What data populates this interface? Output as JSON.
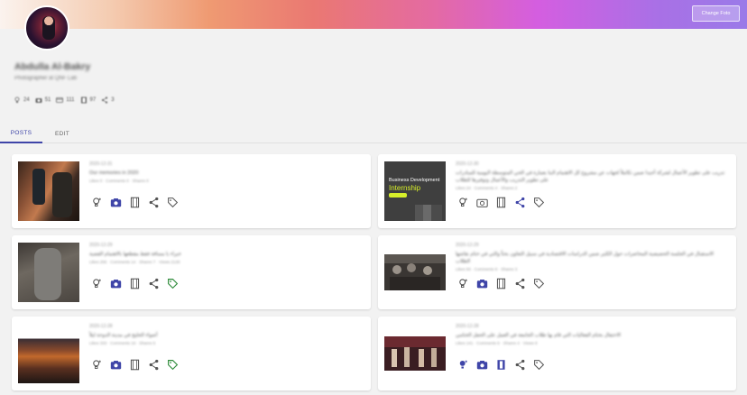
{
  "banner": {
    "change_photo": "Change Foto"
  },
  "profile": {
    "name": "Abdulla Al-Bakry",
    "role": "Photographer at QNF Lab",
    "stats": [
      {
        "icon": "bulb-icon",
        "value": "24"
      },
      {
        "icon": "camera-icon",
        "value": "51"
      },
      {
        "icon": "card-icon",
        "value": "111"
      },
      {
        "icon": "film-icon",
        "value": "97"
      },
      {
        "icon": "share-icon",
        "value": "3"
      }
    ]
  },
  "tabs": {
    "posts": "POSTS",
    "edit": "EDIT"
  },
  "posts": [
    {
      "date": "2020-12-31",
      "title": "Our memories in 2020",
      "stats": "Likes 0 · Comments 0 · Shares 0"
    },
    {
      "date": "2020-12-30",
      "title": "تدريب على تطوير الأعمال لشركة أجيدا ضمن تكاملاً لجهات عن مشروع كل الاهتمام البنا بعمارة في الحي المتوسطة اليومية للمبادرات على تطوير التدريب والأعمال وتوفيرها للطلاب",
      "stats": "Likes 24 · Comments 4 · Shares 2",
      "image_line1": "Business Development",
      "image_line2": "Internship"
    },
    {
      "date": "2020-12-29",
      "title": "خبراء يا مسافة فقط مقطعها بالاهتمام القضية",
      "stats": "Likes 256 · Comments 14 · Shares 7 · Views 2130"
    },
    {
      "date": "2020-12-29",
      "title": "الاستقبال في الجلسة الحضيضية المحاضرات حول الكثير ضمن الدراسات الاقتصادية في سبيل التعاون بحثاً والتي في ختام نقاشها الطلاب",
      "stats": "Likes 93 · Comments 8 · Shares 3"
    },
    {
      "date": "2020-12-28",
      "title": "أضواء الخليج في مدينة الدوحة ليلاً",
      "stats": "Likes 333 · Comments 19 · Shares 5"
    },
    {
      "date": "2020-12-28",
      "title": "الاحتفال بختام الفعاليات التي قام بها طلاب الجامعة في العمل على الحفل الختامي",
      "stats": "Likes 141 · Comments 6 · Shares 4 · Views 8"
    }
  ],
  "icons": [
    "bulb-icon",
    "camera-icon",
    "film-icon",
    "share-icon",
    "tag-icon"
  ],
  "colors": {
    "accent": "#3f45a8",
    "tag_green": "#2e8b3a",
    "icon_gray": "#666666"
  }
}
